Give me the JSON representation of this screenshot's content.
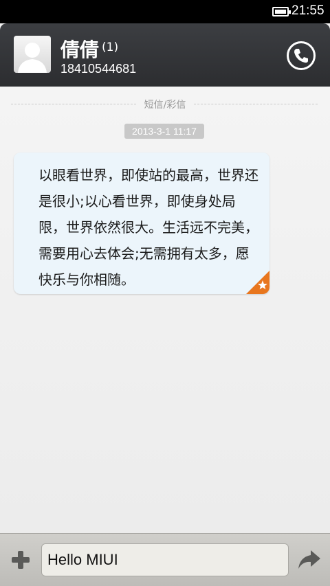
{
  "status_bar": {
    "time": "21:55",
    "battery_icon": "battery-full-icon"
  },
  "header": {
    "contact_name": "倩倩",
    "unread_count": "(1)",
    "phone_number": "18410544681",
    "avatar_icon": "default-avatar-icon",
    "call_icon": "phone-icon"
  },
  "conversation": {
    "divider_label": "短信/彩信",
    "timestamp": "2013-3-1 11:17",
    "message": "以眼看世界，即使站的最高，世界还是很小;以心看世界，即使身处局限，世界依然很大。生活远不完美，需要用心去体会;无需拥有太多，愿快乐与你相随。",
    "badge_icon": "star-icon",
    "bubble_color": "#ecf5fb",
    "badge_color": "#e8761e"
  },
  "input_bar": {
    "value": "Hello MIUI",
    "add_icon": "plus-icon",
    "send_icon": "send-arrow-icon"
  }
}
